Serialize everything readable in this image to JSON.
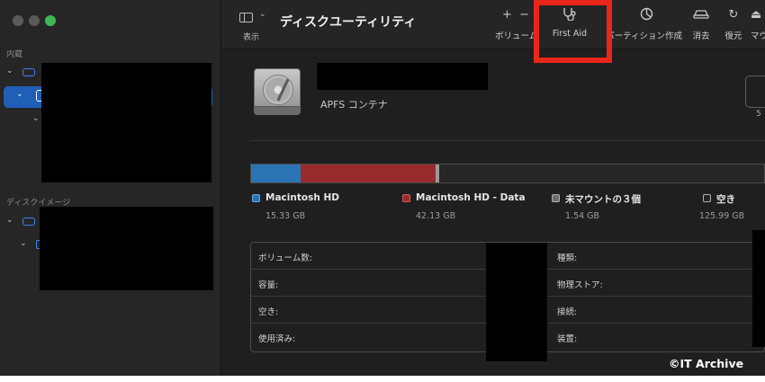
{
  "app": {
    "title": "ディスクユーティリティ"
  },
  "toolbar": {
    "display_label": "表示",
    "buttons": [
      {
        "id": "volume",
        "icon": "plus-minus-icon",
        "label": "ボリューム"
      },
      {
        "id": "first-aid",
        "icon": "stethoscope-icon",
        "label": "First Aid",
        "highlighted": true
      },
      {
        "id": "partition",
        "icon": "pie-chart-icon",
        "label": "パーティション作成"
      },
      {
        "id": "erase",
        "icon": "erase-car-icon",
        "label": "消去"
      },
      {
        "id": "restore",
        "icon": "restore-arrow-icon",
        "label": "復元"
      },
      {
        "id": "mount",
        "icon": "mount-icon",
        "label": "マウント"
      }
    ],
    "highlight_color": "#e8271a"
  },
  "sidebar": {
    "section_internal": "内蔵",
    "section_images": "ディスクイメージ"
  },
  "volume": {
    "subtitle": "APFS コンテナ",
    "capacity_partial": "5"
  },
  "usage": {
    "legend": [
      {
        "name": "Macintosh HD",
        "size": "15.33 GB",
        "color": "#2b74b3"
      },
      {
        "name": "Macintosh HD - Data",
        "size": "42.13 GB",
        "color": "#982b2e"
      },
      {
        "name": "未マウントの３個",
        "size": "1.54 GB",
        "color": "#9a9a9a"
      },
      {
        "name": "空き",
        "size": "125.99 GB",
        "color": "#262626"
      }
    ]
  },
  "info": {
    "left_labels": [
      "ボリューム数:",
      "容量:",
      "空き:",
      "使用済み:"
    ],
    "right_labels": [
      "種類:",
      "物理ストア:",
      "接続:",
      "装置:"
    ]
  },
  "watermark": "©IT Archive"
}
